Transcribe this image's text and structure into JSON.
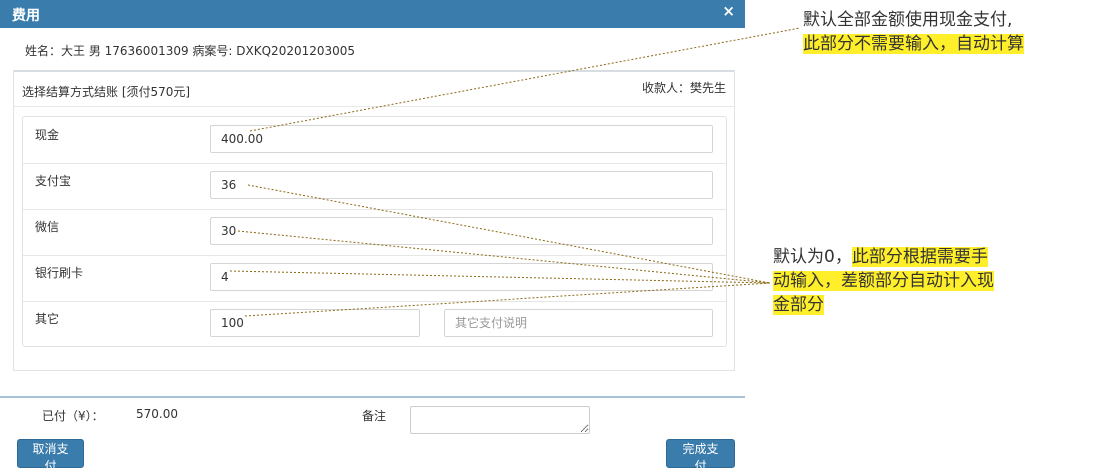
{
  "dialog": {
    "title": "费用",
    "close_icon": "×",
    "patient_line": "姓名：大王 男 17636001309 病案号:  DXKQ20201203005"
  },
  "panel": {
    "title": "选择结算方式结账 [须付570元]",
    "cashier": "收款人：樊先生"
  },
  "payments": [
    {
      "label": "现金",
      "value": "400.00"
    },
    {
      "label": "支付宝",
      "value": "36"
    },
    {
      "label": "微信",
      "value": "30"
    },
    {
      "label": "银行刷卡",
      "value": "4"
    },
    {
      "label": "其它",
      "value": "100",
      "note_placeholder": "其它支付说明"
    }
  ],
  "footer": {
    "paid_label": "已付（¥）：",
    "paid_value": "570.00",
    "remark_label": "备注",
    "cancel_label": "取消支付",
    "done_label": "完成支付"
  },
  "annotations": {
    "top_line1": "默认全部金额使用现金支付,",
    "top_line2": "此部分不需要输入，自动计算",
    "mid_line1_plain": "默认为0，",
    "mid_line1_hl": "此部分根据需要手",
    "mid_line2": "动输入，差额部分自动计入现",
    "mid_line3": "金部分"
  },
  "colors": {
    "header": "#3a7cac",
    "highlight": "#ffef2a",
    "leader_line": "#8b6914"
  }
}
